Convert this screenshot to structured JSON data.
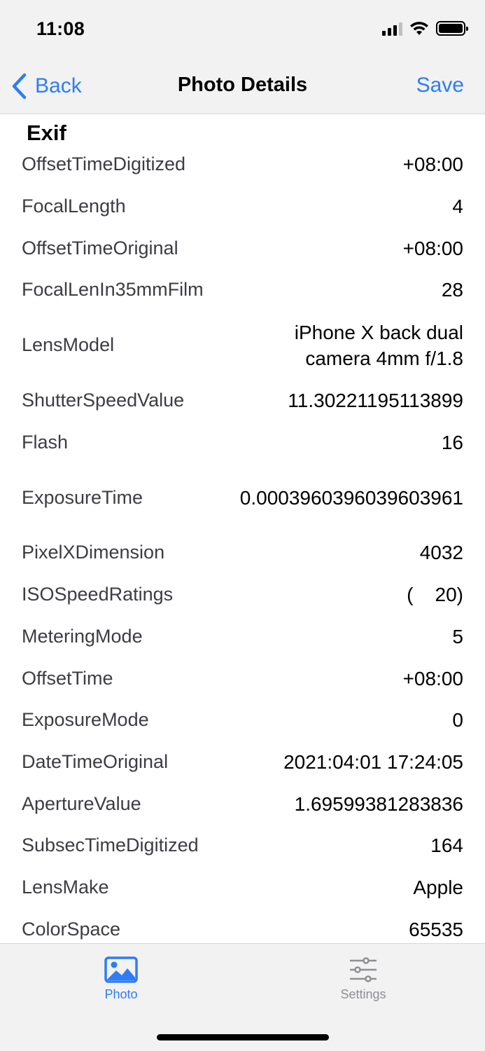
{
  "status_bar": {
    "time": "11:08"
  },
  "nav": {
    "back_label": "Back",
    "title": "Photo Details",
    "save_label": "Save"
  },
  "section": {
    "title": "Exif"
  },
  "rows": [
    {
      "key": "OffsetTimeDigitized",
      "value": "+08:00"
    },
    {
      "key": "FocalLength",
      "value": "4"
    },
    {
      "key": "OffsetTimeOriginal",
      "value": "+08:00"
    },
    {
      "key": "FocalLenIn35mmFilm",
      "value": "28"
    },
    {
      "key": "LensModel",
      "value": "iPhone X back dual camera 4mm f/1.8"
    },
    {
      "key": "ShutterSpeedValue",
      "value": "11.30221195113899"
    },
    {
      "key": "Flash",
      "value": "16"
    },
    {
      "key": "ExposureTime",
      "value": "0.0003960396039603961"
    },
    {
      "key": "PixelXDimension",
      "value": "4032"
    },
    {
      "key": "ISOSpeedRatings",
      "value": "(    20)"
    },
    {
      "key": "MeteringMode",
      "value": "5"
    },
    {
      "key": "OffsetTime",
      "value": "+08:00"
    },
    {
      "key": "ExposureMode",
      "value": "0"
    },
    {
      "key": "DateTimeOriginal",
      "value": "2021:04:01 17:24:05"
    },
    {
      "key": "ApertureValue",
      "value": "1.69599381283836"
    },
    {
      "key": "SubsecTimeDigitized",
      "value": "164"
    },
    {
      "key": "LensMake",
      "value": "Apple"
    },
    {
      "key": "ColorSpace",
      "value": "65535"
    }
  ],
  "tabbar": {
    "tabs": [
      {
        "label": "Photo",
        "icon": "photo-icon",
        "selected": true
      },
      {
        "label": "Settings",
        "icon": "sliders-icon",
        "selected": false
      }
    ]
  },
  "colors": {
    "accent": "#2f7cf6",
    "inactive": "#8e8e93",
    "chrome_bg": "#f2f2f3"
  }
}
